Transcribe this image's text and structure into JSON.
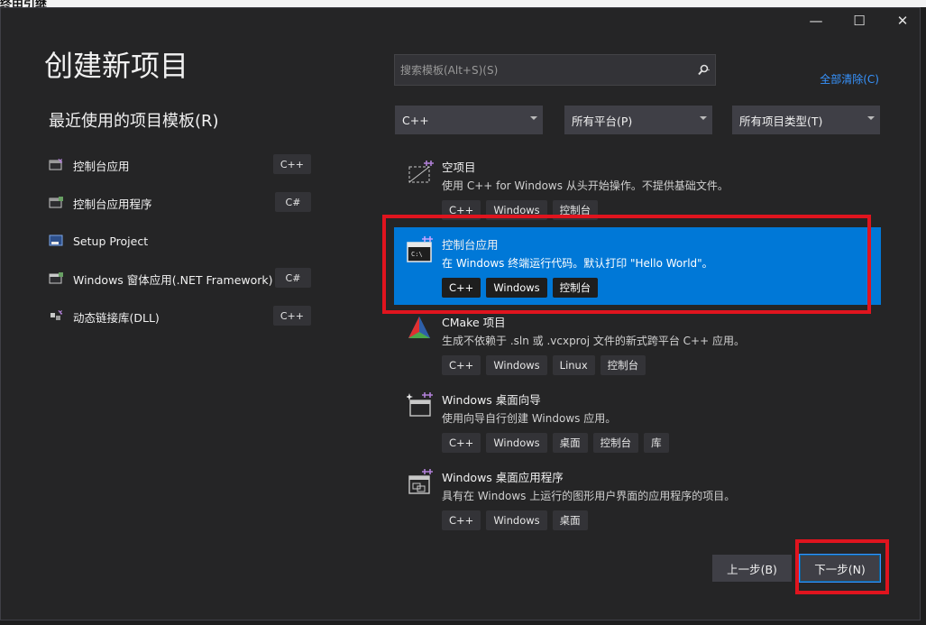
{
  "top_fragment": "终由引继",
  "window_controls": {
    "minimize": "—",
    "maximize": "☐",
    "close": "✕"
  },
  "page_title": "创建新项目",
  "recent": {
    "heading": "最近使用的项目模板(R)",
    "items": [
      {
        "label": "控制台应用",
        "lang": "C++",
        "icon": "console-app-icon"
      },
      {
        "label": "控制台应用程序",
        "lang": "C#",
        "icon": "console-app-icon"
      },
      {
        "label": "Setup Project",
        "lang": "",
        "icon": "setup-project-icon"
      },
      {
        "label": "Windows 窗体应用(.NET Framework)",
        "lang": "C#",
        "icon": "winforms-icon"
      },
      {
        "label": "动态链接库(DLL)",
        "lang": "C++",
        "icon": "dll-icon"
      }
    ]
  },
  "search": {
    "placeholder": "搜索模板(Alt+S)(S)",
    "icon": "search-icon"
  },
  "clear_all": "全部清除(C)",
  "filters": {
    "language": "C++",
    "platform": "所有平台(P)",
    "project_type": "所有项目类型(T)"
  },
  "templates": [
    {
      "name": "空项目",
      "desc": "使用 C++ for Windows 从头开始操作。不提供基础文件。",
      "tags": [
        "C++",
        "Windows",
        "控制台"
      ],
      "selected": false,
      "icon": "empty-project-icon"
    },
    {
      "name": "控制台应用",
      "desc": "在 Windows 终端运行代码。默认打印 \"Hello World\"。",
      "tags": [
        "C++",
        "Windows",
        "控制台"
      ],
      "selected": true,
      "icon": "console-app-icon"
    },
    {
      "name": "CMake 项目",
      "desc": "生成不依赖于 .sln 或 .vcxproj 文件的新式跨平台 C++ 应用。",
      "tags": [
        "C++",
        "Windows",
        "Linux",
        "控制台"
      ],
      "selected": false,
      "icon": "cmake-icon"
    },
    {
      "name": "Windows 桌面向导",
      "desc": "使用向导自行创建 Windows 应用。",
      "tags": [
        "C++",
        "Windows",
        "桌面",
        "控制台",
        "库"
      ],
      "selected": false,
      "icon": "desktop-wizard-icon"
    },
    {
      "name": "Windows 桌面应用程序",
      "desc": "具有在 Windows 上运行的图形用户界面的应用程序的项目。",
      "tags": [
        "C++",
        "Windows",
        "桌面"
      ],
      "selected": false,
      "icon": "desktop-app-icon"
    }
  ],
  "buttons": {
    "back": "上一步(B)",
    "next": "下一步(N)"
  },
  "colors": {
    "accent": "#0078d7",
    "background": "#252526",
    "highlight": "#e0141e",
    "link": "#3794ff"
  }
}
